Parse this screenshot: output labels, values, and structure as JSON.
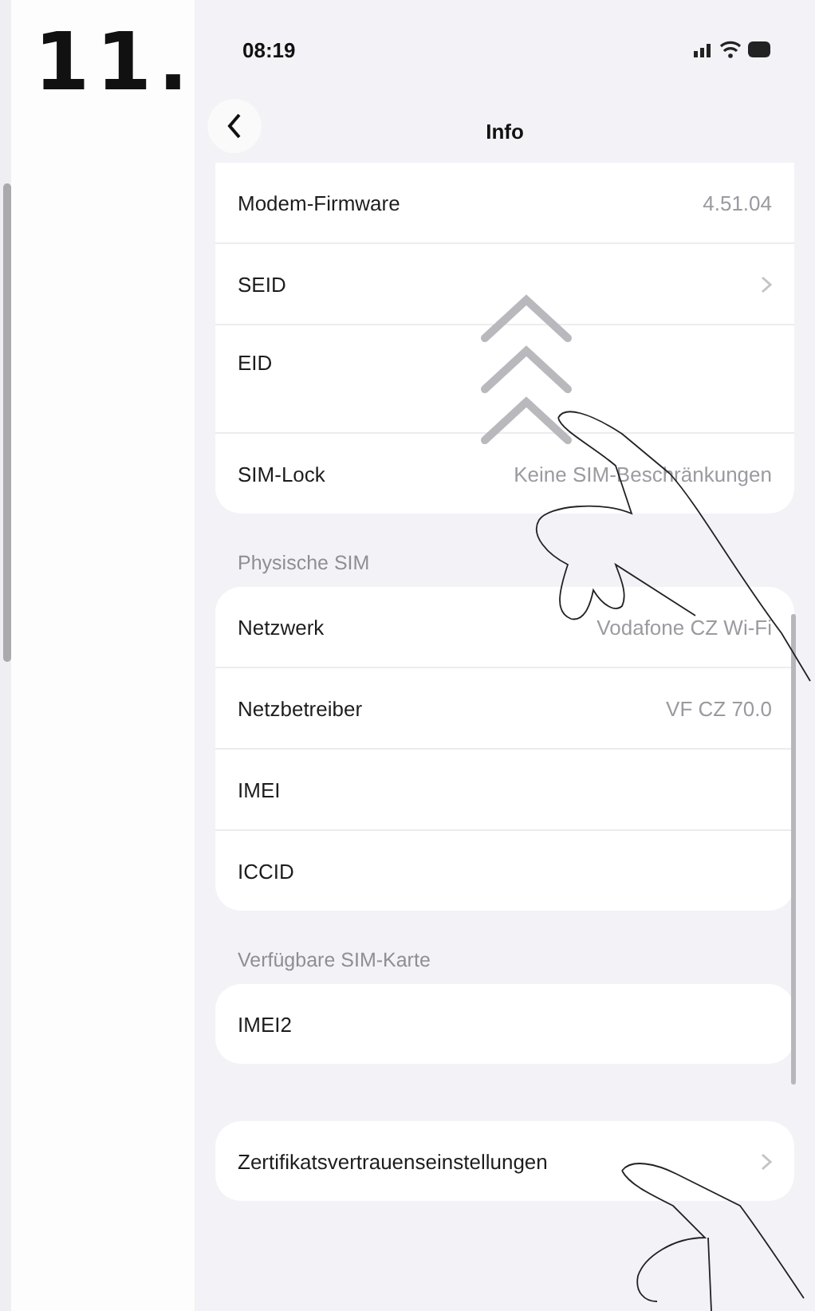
{
  "step": "11.",
  "status_bar": {
    "time": "08:19"
  },
  "nav": {
    "title": "Info"
  },
  "groups": [
    {
      "rows": [
        {
          "label": "Modem-Firmware",
          "value": "4.51.04",
          "chevron": false,
          "kind": "plain"
        },
        {
          "label": "SEID",
          "chevron": true,
          "kind": "plain"
        },
        {
          "label": "EID",
          "chevron": false,
          "kind": "tall"
        },
        {
          "label": "SIM-Lock",
          "value": "Keine SIM-Beschränkungen",
          "chevron": false,
          "kind": "plain"
        }
      ]
    },
    {
      "header": "Physische SIM",
      "rows": [
        {
          "label": "Netzwerk",
          "value": "Vodafone CZ Wi-Fi",
          "chevron": false,
          "kind": "plain"
        },
        {
          "label": "Netzbetreiber",
          "value": "VF CZ 70.0",
          "chevron": false,
          "kind": "plain"
        },
        {
          "label": "IMEI",
          "chevron": false,
          "kind": "plain"
        },
        {
          "label": "ICCID",
          "chevron": false,
          "kind": "plain"
        }
      ]
    },
    {
      "header": "Verfügbare SIM-Karte",
      "rows": [
        {
          "label": "IMEI2",
          "chevron": false,
          "kind": "plain"
        }
      ]
    },
    {
      "rows": [
        {
          "label": "Zertifikatsvertrauenseinstellungen",
          "chevron": true,
          "kind": "plain"
        }
      ]
    }
  ]
}
